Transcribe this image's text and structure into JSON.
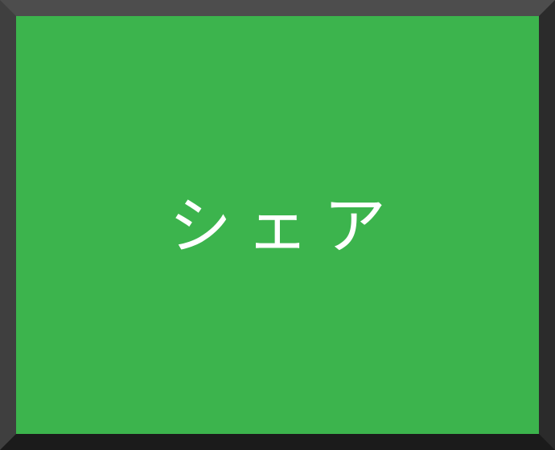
{
  "share": {
    "label": "シェア",
    "background_color": "#3cb44d",
    "text_color": "#ffffff",
    "frame_color": "#2a2a2a"
  }
}
